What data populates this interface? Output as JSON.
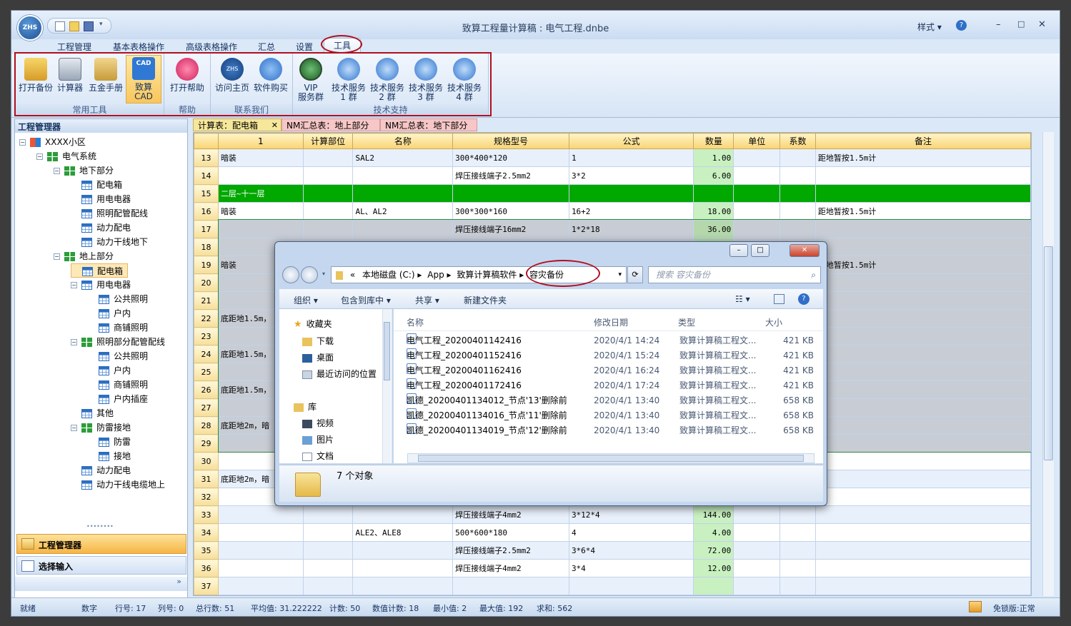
{
  "app": {
    "title": "致算工程量计算稿 : 电气工程.dnbe",
    "style_label": "样式",
    "logo": "ZHS"
  },
  "tabs": [
    "工程管理",
    "基本表格操作",
    "高级表格操作",
    "汇总",
    "设置",
    "工具"
  ],
  "ribbon": {
    "groups": [
      {
        "label": "常用工具",
        "buttons": [
          "打开备份",
          "计算器",
          "五金手册",
          "致算CAD"
        ]
      },
      {
        "label": "帮助",
        "buttons": [
          "打开帮助"
        ]
      },
      {
        "label": "联系我们",
        "buttons": [
          "访问主页",
          "软件购买"
        ]
      },
      {
        "label": "技术支持",
        "buttons": [
          "VIP\n服务群",
          "技术服务\n1 群",
          "技术服务\n2 群",
          "技术服务\n3 群",
          "技术服务\n4 群"
        ]
      }
    ]
  },
  "left_panel": {
    "title": "工程管理器",
    "tree": [
      {
        "label": "XXXX小区",
        "depth": 0,
        "toggle": "−",
        "icon": "multi"
      },
      {
        "label": "电气系统",
        "depth": 1,
        "toggle": "−",
        "icon": "green"
      },
      {
        "label": "地下部分",
        "depth": 2,
        "toggle": "−",
        "icon": "green"
      },
      {
        "label": "配电箱",
        "depth": 3,
        "icon": "blue"
      },
      {
        "label": "用电电器",
        "depth": 3,
        "icon": "blue"
      },
      {
        "label": "照明配管配线",
        "depth": 3,
        "icon": "blue"
      },
      {
        "label": "动力配电",
        "depth": 3,
        "icon": "blue"
      },
      {
        "label": "动力干线地下",
        "depth": 3,
        "icon": "blue"
      },
      {
        "label": "地上部分",
        "depth": 2,
        "toggle": "−",
        "icon": "green"
      },
      {
        "label": "配电箱",
        "depth": 3,
        "icon": "blue",
        "selected": true
      },
      {
        "label": "用电电器",
        "depth": 3,
        "toggle": "−",
        "icon": "blue"
      },
      {
        "label": "公共照明",
        "depth": 4,
        "icon": "blue"
      },
      {
        "label": "户内",
        "depth": 4,
        "icon": "blue"
      },
      {
        "label": "商铺照明",
        "depth": 4,
        "icon": "blue"
      },
      {
        "label": "照明部分配管配线",
        "depth": 3,
        "toggle": "−",
        "icon": "green"
      },
      {
        "label": "公共照明",
        "depth": 4,
        "icon": "blue"
      },
      {
        "label": "户内",
        "depth": 4,
        "icon": "blue"
      },
      {
        "label": "商铺照明",
        "depth": 4,
        "icon": "blue"
      },
      {
        "label": "户内插座",
        "depth": 4,
        "icon": "blue"
      },
      {
        "label": "其他",
        "depth": 3,
        "icon": "blue"
      },
      {
        "label": "防雷接地",
        "depth": 3,
        "toggle": "−",
        "icon": "green"
      },
      {
        "label": "防雷",
        "depth": 4,
        "icon": "blue"
      },
      {
        "label": "接地",
        "depth": 4,
        "icon": "blue"
      },
      {
        "label": "动力配电",
        "depth": 3,
        "icon": "blue"
      },
      {
        "label": "动力干线电缆地上",
        "depth": 3,
        "icon": "blue"
      }
    ],
    "bottom_items": [
      "工程管理器",
      "选择输入"
    ]
  },
  "sheet_tabs": [
    {
      "label": "计算表：配电箱",
      "active": true,
      "color": "#f6e79a"
    },
    {
      "label": "NM汇总表：地上部分",
      "color": "#f7c6c6"
    },
    {
      "label": "NM汇总表：地下部分",
      "color": "#f7c6c6"
    }
  ],
  "grid": {
    "headers": [
      "",
      "1",
      "计算部位",
      "名称",
      "规格型号",
      "公式",
      "数量",
      "单位",
      "系数",
      "备注"
    ],
    "rows": [
      {
        "n": "13",
        "c1": "暗装",
        "c2": "",
        "c3": "SAL2",
        "c4": "300*400*120",
        "c5": "1",
        "qty": "1.00",
        "c9": "距地暂按1.5m计",
        "cls": "alt"
      },
      {
        "n": "14",
        "c1": "",
        "c2": "",
        "c3": "",
        "c4": "焊压接线端子2.5mm2",
        "c5": "3*2",
        "qty": "6.00",
        "c9": ""
      },
      {
        "n": "15",
        "c1": "二层~十一层",
        "c2": "",
        "c3": "",
        "c4": "",
        "c5": "",
        "qty": "",
        "c9": "",
        "cls": "hl"
      },
      {
        "n": "16",
        "c1": "暗装",
        "c2": "",
        "c3": "AL、AL2",
        "c4": "300*300*160",
        "c5": "16+2",
        "qty": "18.00",
        "c9": "距地暂按1.5m计"
      },
      {
        "n": "17",
        "c1": "",
        "c2": "",
        "c3": "",
        "c4": "焊压接线端子16mm2",
        "c5": "1*2*18",
        "qty": "36.00",
        "c9": "",
        "cls": "sel"
      },
      {
        "n": "18",
        "c1": "",
        "c2": "",
        "c3": "",
        "c4": "",
        "c5": "",
        "qty": "",
        "c9": "",
        "cls": "sel"
      },
      {
        "n": "19",
        "c1": "暗装",
        "c2": "",
        "c3": "",
        "c4": "",
        "c5": "",
        "qty": "",
        "c9": "距地暂按1.5m计",
        "cls": "sel"
      },
      {
        "n": "20",
        "c1": "",
        "c2": "",
        "c3": "",
        "c4": "",
        "c5": "",
        "qty": "",
        "c9": "",
        "cls": "sel"
      },
      {
        "n": "21",
        "c1": "",
        "c2": "",
        "c3": "",
        "c4": "",
        "c5": "",
        "qty": "",
        "c9": "",
        "cls": "sel"
      },
      {
        "n": "22",
        "c1": "底距地1.5m，",
        "c2": "",
        "c3": "",
        "c4": "",
        "c5": "",
        "qty": "",
        "c9": "",
        "cls": "sel"
      },
      {
        "n": "23",
        "c1": "",
        "c2": "",
        "c3": "",
        "c4": "",
        "c5": "",
        "qty": "",
        "c9": "",
        "cls": "sel"
      },
      {
        "n": "24",
        "c1": "底距地1.5m，",
        "c2": "",
        "c3": "",
        "c4": "",
        "c5": "",
        "qty": "",
        "c9": "",
        "cls": "sel"
      },
      {
        "n": "25",
        "c1": "",
        "c2": "",
        "c3": "",
        "c4": "",
        "c5": "",
        "qty": "",
        "c9": "",
        "cls": "sel"
      },
      {
        "n": "26",
        "c1": "底距地1.5m，",
        "c2": "",
        "c3": "",
        "c4": "",
        "c5": "",
        "qty": "",
        "c9": "",
        "cls": "sel"
      },
      {
        "n": "27",
        "c1": "",
        "c2": "",
        "c3": "",
        "c4": "",
        "c5": "",
        "qty": "",
        "c9": "",
        "cls": "sel"
      },
      {
        "n": "28",
        "c1": "底距地2m，暗",
        "c2": "",
        "c3": "",
        "c4": "",
        "c5": "",
        "qty": "",
        "c9": "",
        "cls": "sel"
      },
      {
        "n": "29",
        "c1": "",
        "c2": "",
        "c3": "",
        "c4": "",
        "c5": "",
        "qty": "",
        "c9": "",
        "cls": "sel"
      },
      {
        "n": "30",
        "c1": "",
        "c2": "",
        "c3": "",
        "c4": "",
        "c5": "",
        "qty": "",
        "c9": ""
      },
      {
        "n": "31",
        "c1": "底距地2m，暗",
        "c2": "",
        "c3": "",
        "c4": "",
        "c5": "",
        "qty": "",
        "c9": "",
        "cls": "alt"
      },
      {
        "n": "32",
        "c1": "",
        "c2": "",
        "c3": "",
        "c4": "",
        "c5": "",
        "qty": "",
        "c9": ""
      },
      {
        "n": "33",
        "c1": "",
        "c2": "",
        "c3": "",
        "c4": "焊压接线端子4mm2",
        "c5": "3*12*4",
        "qty": "144.00",
        "c9": "",
        "cls": "alt"
      },
      {
        "n": "34",
        "c1": "",
        "c2": "",
        "c3": "ALE2、ALE8",
        "c4": "500*600*180",
        "c5": "4",
        "qty": "4.00",
        "c9": ""
      },
      {
        "n": "35",
        "c1": "",
        "c2": "",
        "c3": "",
        "c4": "焊压接线端子2.5mm2",
        "c5": "3*6*4",
        "qty": "72.00",
        "c9": "",
        "cls": "alt"
      },
      {
        "n": "36",
        "c1": "",
        "c2": "",
        "c3": "",
        "c4": "焊压接线端子4mm2",
        "c5": "3*4",
        "qty": "12.00",
        "c9": ""
      },
      {
        "n": "37",
        "c1": "",
        "c2": "",
        "c3": "",
        "c4": "",
        "c5": "",
        "qty": "",
        "c9": "",
        "cls": "alt"
      }
    ]
  },
  "statusbar": {
    "ready": "就绪",
    "mode": "数字",
    "row": "行号: 17",
    "col": "列号: 0",
    "total": "总行数: 51",
    "avg": "平均值: 31.222222",
    "count": "计数: 50",
    "numcount": "数值计数: 18",
    "min": "最小值: 2",
    "max": "最大值: 192",
    "sum": "求和: 562",
    "edition": "免锁版:正常"
  },
  "explorer": {
    "address": [
      "«",
      "本地磁盘 (C:)",
      "App",
      "致算计算稿软件",
      "容灾备份"
    ],
    "search_placeholder": "搜索 容灾备份",
    "toolbar": [
      "组织 ▾",
      "包含到库中 ▾",
      "共享 ▾",
      "新建文件夹"
    ],
    "nav": {
      "favorites": "收藏夹",
      "downloads": "下载",
      "desktop": "桌面",
      "recent": "最近访问的位置",
      "libraries": "库",
      "videos": "视频",
      "pictures": "图片",
      "documents": "文档"
    },
    "columns": [
      "名称",
      "修改日期",
      "类型",
      "大小"
    ],
    "files": [
      {
        "name": "电气工程_20200401142416",
        "date": "2020/4/1 14:24",
        "type": "致算计算稿工程文...",
        "size": "421 KB"
      },
      {
        "name": "电气工程_20200401152416",
        "date": "2020/4/1 15:24",
        "type": "致算计算稿工程文...",
        "size": "421 KB"
      },
      {
        "name": "电气工程_20200401162416",
        "date": "2020/4/1 16:24",
        "type": "致算计算稿工程文...",
        "size": "421 KB"
      },
      {
        "name": "电气工程_20200401172416",
        "date": "2020/4/1 17:24",
        "type": "致算计算稿工程文...",
        "size": "421 KB"
      },
      {
        "name": "凯德_20200401134012_节点'13'删除前",
        "date": "2020/4/1 13:40",
        "type": "致算计算稿工程文...",
        "size": "658 KB"
      },
      {
        "name": "凯德_20200401134016_节点'11'删除前",
        "date": "2020/4/1 13:40",
        "type": "致算计算稿工程文...",
        "size": "658 KB"
      },
      {
        "name": "凯德_20200401134019_节点'12'删除前",
        "date": "2020/4/1 13:40",
        "type": "致算计算稿工程文...",
        "size": "658 KB"
      }
    ],
    "object_count": "7 个对象"
  }
}
